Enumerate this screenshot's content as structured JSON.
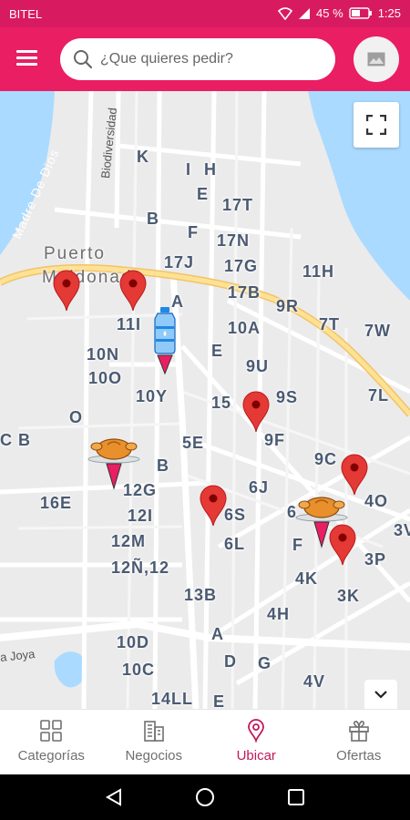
{
  "status_bar": {
    "carrier": "BITEL",
    "battery": "45 %",
    "time": "1:25"
  },
  "header": {
    "search_placeholder": "¿Que quieres pedir?"
  },
  "map": {
    "place_names": [
      "Puerto",
      "Maldonado"
    ],
    "river_label": "Madre De Dios",
    "street_labels": [
      "Biodiversidad",
      "a Joya"
    ],
    "block_labels": [
      "K",
      "I",
      "H",
      "E",
      "17T",
      "B",
      "F",
      "17N",
      "17J",
      "17G",
      "11H",
      "A",
      "17B",
      "9R",
      "11I",
      "7T",
      "7W",
      "10A",
      "10N",
      "E",
      "9U",
      "10O",
      "10Y",
      "7L",
      "15",
      "9S",
      "O",
      "9F",
      "C B",
      "5E",
      "9C",
      "B",
      "12G",
      "6J",
      "4O",
      "16E",
      "12I",
      "6S",
      "6",
      "3V",
      "12M",
      "6L",
      "F",
      "3P",
      "12Ñ,12",
      "4K",
      "13B",
      "3K",
      "4H",
      "A",
      "10D",
      "D",
      "G",
      "10C",
      "4V",
      "14LL",
      "E"
    ]
  },
  "bottom_nav": {
    "items": [
      {
        "label": "Categorías"
      },
      {
        "label": "Negocios"
      },
      {
        "label": "Ubicar"
      },
      {
        "label": "Ofertas"
      }
    ]
  },
  "colors": {
    "brand": "#e91e63",
    "status_bar": "#d81b60",
    "active_tab": "#c2185b",
    "pin": "#e53935",
    "river": "#aadaff",
    "highway": "#fde293"
  }
}
